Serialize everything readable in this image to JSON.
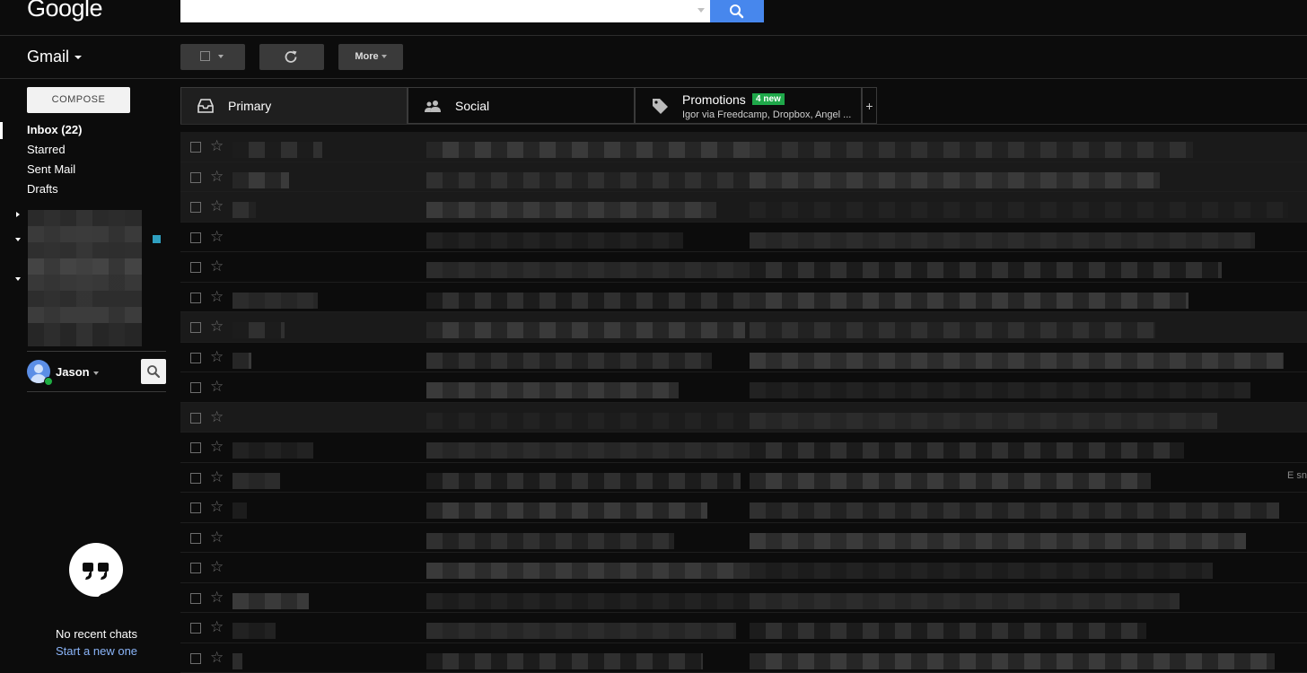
{
  "header": {
    "logo": "Google",
    "search": {
      "value": "",
      "placeholder": ""
    }
  },
  "toolbar": {
    "app_name": "Gmail",
    "more_label": "More"
  },
  "sidebar": {
    "compose_label": "COMPOSE",
    "nav": [
      {
        "label": "Inbox (22)",
        "active": true
      },
      {
        "label": "Starred"
      },
      {
        "label": "Sent Mail"
      },
      {
        "label": "Drafts"
      }
    ],
    "user": {
      "name": "Jason"
    },
    "hangouts": {
      "no_chats": "No recent chats",
      "start_new": "Start a new one"
    }
  },
  "tabs": [
    {
      "label": "Primary",
      "icon": "inbox-icon",
      "selected": true
    },
    {
      "label": "Social",
      "icon": "people-icon"
    },
    {
      "label": "Promotions",
      "icon": "tag-icon",
      "badge": "4 new",
      "subtitle": "Igor via Freedcamp, Dropbox, Angel ..."
    }
  ],
  "tab_add": "+",
  "mail_rows": [
    {
      "highlight": true,
      "tail": ""
    },
    {
      "highlight": true,
      "tail": ""
    },
    {
      "highlight": true,
      "tail": ""
    },
    {
      "highlight": false,
      "tail": ""
    },
    {
      "highlight": false,
      "tail": ""
    },
    {
      "highlight": false,
      "tail": ""
    },
    {
      "highlight": true,
      "tail": ""
    },
    {
      "highlight": false,
      "tail": ""
    },
    {
      "highlight": false,
      "tail": ""
    },
    {
      "highlight": true,
      "tail": ""
    },
    {
      "highlight": false,
      "tail": ""
    },
    {
      "highlight": false,
      "tail": "E sn"
    },
    {
      "highlight": false,
      "tail": ""
    },
    {
      "highlight": false,
      "tail": ""
    },
    {
      "highlight": false,
      "tail": ""
    },
    {
      "highlight": false,
      "tail": ""
    },
    {
      "highlight": false,
      "tail": ""
    },
    {
      "highlight": false,
      "tail": ""
    }
  ],
  "colors": {
    "background": "#0c0c0c",
    "search_button": "#4787ed",
    "badge": "#1fa84a",
    "link": "#8ab4f8"
  }
}
